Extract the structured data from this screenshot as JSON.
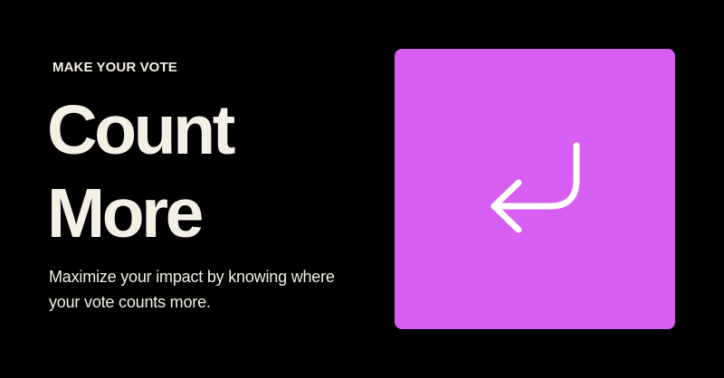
{
  "hero": {
    "eyebrow": "MAKE YOUR VOTE",
    "headline_line1": "Count",
    "headline_line2": "More",
    "description": "Maximize your impact by knowing where your vote counts more."
  },
  "card": {
    "icon": "corner-down-left-arrow-icon",
    "color": "#d65ef0",
    "icon_color": "#ffffff"
  },
  "theme": {
    "background": "#000000",
    "text": "#f4f0e6"
  }
}
